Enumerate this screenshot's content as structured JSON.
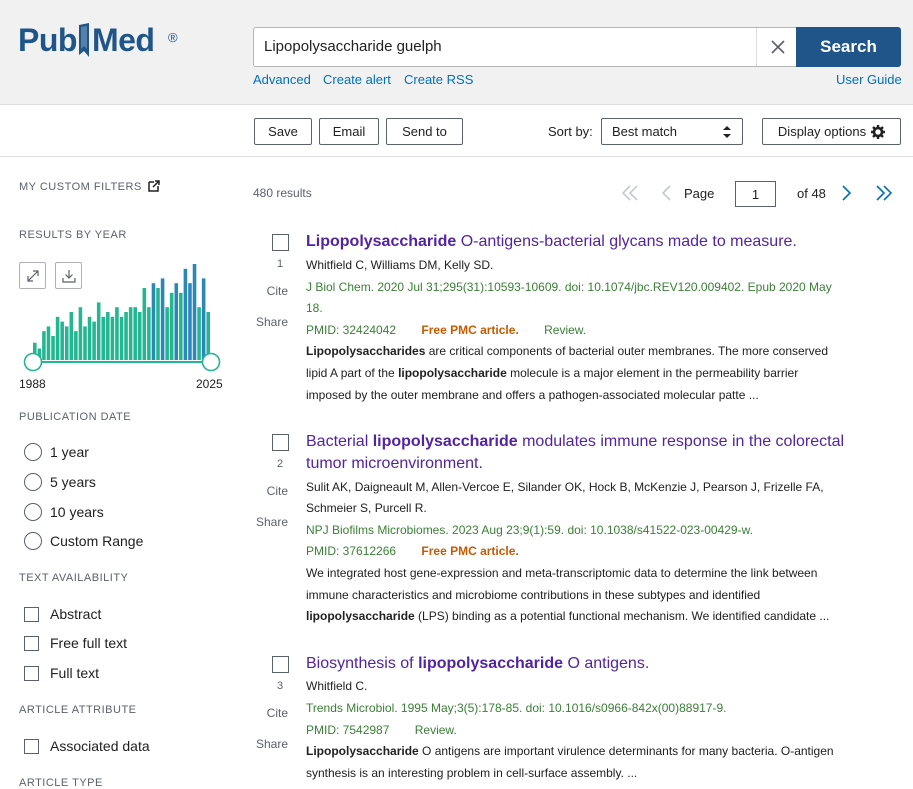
{
  "app": {
    "logo_text_1": "Pub",
    "logo_text_2": "Med",
    "logo_reg": "®"
  },
  "search": {
    "query": "Lipopolysaccharide guelph",
    "button_label": "Search"
  },
  "header_links": {
    "advanced": "Advanced",
    "create_alert": "Create alert",
    "create_rss": "Create RSS",
    "user_guide": "User Guide"
  },
  "toolbar": {
    "save": "Save",
    "email": "Email",
    "send_to": "Send to",
    "sort_label": "Sort by:",
    "sort_value": "Best match",
    "display_options": "Display options"
  },
  "sidebar": {
    "custom_filters": "MY CUSTOM FILTERS",
    "results_by_year": "RESULTS BY YEAR",
    "year_start": "1988",
    "year_end": "2025",
    "year_histogram": [
      0.18,
      0.12,
      0.3,
      0.35,
      0.25,
      0.45,
      0.4,
      0.35,
      0.5,
      0.3,
      0.55,
      0.35,
      0.45,
      0.4,
      0.6,
      0.45,
      0.5,
      0.45,
      0.55,
      0.45,
      0.5,
      0.55,
      0.55,
      0.5,
      0.75,
      0.55,
      0.8,
      0.75,
      0.85,
      0.55,
      0.7,
      0.8,
      0.7,
      0.95,
      0.8,
      1.0,
      0.55,
      0.85,
      0.5
    ],
    "histogram_color": "#24b591",
    "histogram_accent": "#2a87b8",
    "publication_date": "PUBLICATION DATE",
    "date_options": [
      "1 year",
      "5 years",
      "10 years",
      "Custom Range"
    ],
    "text_availability": "TEXT AVAILABILITY",
    "text_options": [
      "Abstract",
      "Free full text",
      "Full text"
    ],
    "article_attribute": "ARTICLE ATTRIBUTE",
    "attribute_options": [
      "Associated data"
    ],
    "article_type": "ARTICLE TYPE"
  },
  "results": {
    "count": "480 results",
    "page_label": "Page",
    "page_value": "1",
    "of_label": "of 48",
    "cite_label": "Cite",
    "share_label": "Share",
    "items": [
      {
        "num": "1",
        "title_bold": "Lipopolysaccharide",
        "title_rest": " O-antigens-bacterial glycans made to measure.",
        "authors": "Whitfield C, Williams DM, Kelly SD.",
        "journal_l1": "J Biol Chem. 2020 Jul 31;295(31):10593-10609. doi: 10.1074/jbc.REV120.009402. Epub 2020 May",
        "journal_l2": "18.",
        "pmid": "PMID: 32424042",
        "free_pmc": "Free PMC article.",
        "review": "Review.",
        "snip_l1_bold": "Lipopolysaccharides",
        "snip_l1": " are critical components of bacterial outer membranes. The more conserved",
        "snip_l2_a": "lipid A part of the ",
        "snip_l2_bold": "lipopolysaccharide",
        "snip_l2_b": " molecule is a major element in the permeability barrier",
        "snip_l3": "imposed by the outer membrane and offers a pathogen-associated molecular patte ..."
      },
      {
        "num": "2",
        "title_a": "Bacterial ",
        "title_bold": "lipopolysaccharide",
        "title_b": " modulates immune response in the colorectal",
        "title_l2": "tumor microenvironment.",
        "authors_l1": "Sulit AK, Daigneault M, Allen-Vercoe E, Silander OK, Hock B, McKenzie J, Pearson J, Frizelle FA,",
        "authors_l2": "Schmeier S, Purcell R.",
        "journal": "NPJ Biofilms Microbiomes. 2023 Aug 23;9(1):59. doi: 10.1038/s41522-023-00429-w.",
        "pmid": "PMID: 37612266",
        "free_pmc": "Free PMC article.",
        "snip_l1": "We integrated host gene-expression and meta-transcriptomic data to determine the link between",
        "snip_l2": "immune characteristics and microbiome contributions in these subtypes and identified",
        "snip_l3_bold": "lipopolysaccharide",
        "snip_l3": " (LPS) binding as a potential functional mechanism. We identified candidate ..."
      },
      {
        "num": "3",
        "title_a": "Biosynthesis of ",
        "title_bold": "lipopolysaccharide",
        "title_b": " O antigens.",
        "authors": "Whitfield C.",
        "journal": "Trends Microbiol. 1995 May;3(5):178-85. doi: 10.1016/s0966-842x(00)88917-9.",
        "pmid": "PMID: 7542987",
        "review": "Review.",
        "snip_l1_bold": "Lipopolysaccharide",
        "snip_l1": " O antigens are important virulence determinants for many bacteria. O-antigen",
        "snip_l2": "synthesis is an interesting problem in cell-surface assembly. ..."
      }
    ]
  }
}
